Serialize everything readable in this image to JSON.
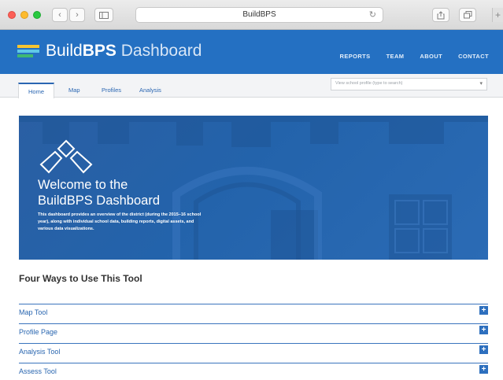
{
  "browser": {
    "url": "BuildBPS"
  },
  "site": {
    "brand_bold": "BPS",
    "brand_build": "Build",
    "brand_dashboard": " Dashboard",
    "topnav": [
      "REPORTS",
      "TEAM",
      "ABOUT",
      "CONTACT"
    ]
  },
  "subnav": {
    "tabs": [
      "Home",
      "Map",
      "Profiles",
      "Analysis"
    ],
    "selector_placeholder": "View school profile (type to search)"
  },
  "hero": {
    "title_line1": "Welcome to the",
    "title_line2": "BuildBPS Dashboard",
    "description": "This dashboard provides an overview of the district (during the 2015–16 school year), along with individual school data, building reports, digital assets, and various data visualizations."
  },
  "ways": {
    "title": "Four Ways to Use This Tool",
    "items": [
      "Map Tool",
      "Profile Page",
      "Analysis Tool",
      "Assess Tool"
    ],
    "expand_icon": "plus-icon"
  },
  "colors": {
    "header_blue": "#2470c2",
    "accent_blue": "#2966b0",
    "logo_yellow": "#f7c531",
    "logo_cyan": "#5fc8e8",
    "logo_green": "#3fb873"
  }
}
